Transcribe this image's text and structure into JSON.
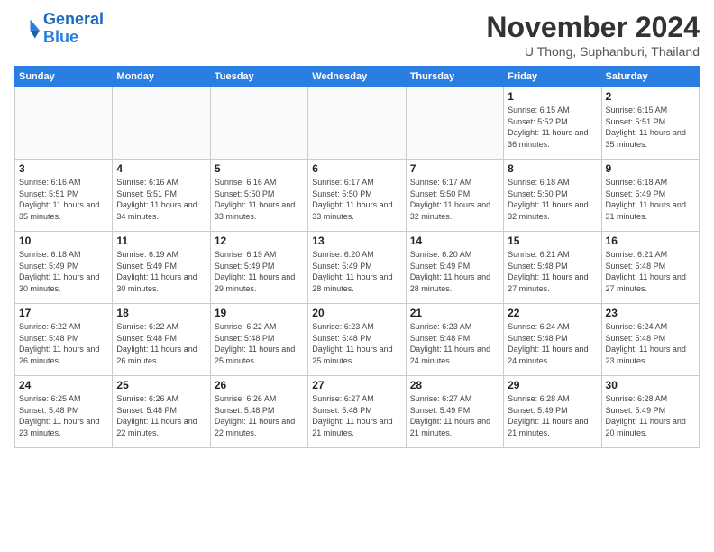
{
  "header": {
    "logo_line1": "General",
    "logo_line2": "Blue",
    "month_title": "November 2024",
    "location": "U Thong, Suphanburi, Thailand"
  },
  "weekdays": [
    "Sunday",
    "Monday",
    "Tuesday",
    "Wednesday",
    "Thursday",
    "Friday",
    "Saturday"
  ],
  "weeks": [
    [
      {
        "day": "",
        "info": ""
      },
      {
        "day": "",
        "info": ""
      },
      {
        "day": "",
        "info": ""
      },
      {
        "day": "",
        "info": ""
      },
      {
        "day": "",
        "info": ""
      },
      {
        "day": "1",
        "info": "Sunrise: 6:15 AM\nSunset: 5:52 PM\nDaylight: 11 hours and 36 minutes."
      },
      {
        "day": "2",
        "info": "Sunrise: 6:15 AM\nSunset: 5:51 PM\nDaylight: 11 hours and 35 minutes."
      }
    ],
    [
      {
        "day": "3",
        "info": "Sunrise: 6:16 AM\nSunset: 5:51 PM\nDaylight: 11 hours and 35 minutes."
      },
      {
        "day": "4",
        "info": "Sunrise: 6:16 AM\nSunset: 5:51 PM\nDaylight: 11 hours and 34 minutes."
      },
      {
        "day": "5",
        "info": "Sunrise: 6:16 AM\nSunset: 5:50 PM\nDaylight: 11 hours and 33 minutes."
      },
      {
        "day": "6",
        "info": "Sunrise: 6:17 AM\nSunset: 5:50 PM\nDaylight: 11 hours and 33 minutes."
      },
      {
        "day": "7",
        "info": "Sunrise: 6:17 AM\nSunset: 5:50 PM\nDaylight: 11 hours and 32 minutes."
      },
      {
        "day": "8",
        "info": "Sunrise: 6:18 AM\nSunset: 5:50 PM\nDaylight: 11 hours and 32 minutes."
      },
      {
        "day": "9",
        "info": "Sunrise: 6:18 AM\nSunset: 5:49 PM\nDaylight: 11 hours and 31 minutes."
      }
    ],
    [
      {
        "day": "10",
        "info": "Sunrise: 6:18 AM\nSunset: 5:49 PM\nDaylight: 11 hours and 30 minutes."
      },
      {
        "day": "11",
        "info": "Sunrise: 6:19 AM\nSunset: 5:49 PM\nDaylight: 11 hours and 30 minutes."
      },
      {
        "day": "12",
        "info": "Sunrise: 6:19 AM\nSunset: 5:49 PM\nDaylight: 11 hours and 29 minutes."
      },
      {
        "day": "13",
        "info": "Sunrise: 6:20 AM\nSunset: 5:49 PM\nDaylight: 11 hours and 28 minutes."
      },
      {
        "day": "14",
        "info": "Sunrise: 6:20 AM\nSunset: 5:49 PM\nDaylight: 11 hours and 28 minutes."
      },
      {
        "day": "15",
        "info": "Sunrise: 6:21 AM\nSunset: 5:48 PM\nDaylight: 11 hours and 27 minutes."
      },
      {
        "day": "16",
        "info": "Sunrise: 6:21 AM\nSunset: 5:48 PM\nDaylight: 11 hours and 27 minutes."
      }
    ],
    [
      {
        "day": "17",
        "info": "Sunrise: 6:22 AM\nSunset: 5:48 PM\nDaylight: 11 hours and 26 minutes."
      },
      {
        "day": "18",
        "info": "Sunrise: 6:22 AM\nSunset: 5:48 PM\nDaylight: 11 hours and 26 minutes."
      },
      {
        "day": "19",
        "info": "Sunrise: 6:22 AM\nSunset: 5:48 PM\nDaylight: 11 hours and 25 minutes."
      },
      {
        "day": "20",
        "info": "Sunrise: 6:23 AM\nSunset: 5:48 PM\nDaylight: 11 hours and 25 minutes."
      },
      {
        "day": "21",
        "info": "Sunrise: 6:23 AM\nSunset: 5:48 PM\nDaylight: 11 hours and 24 minutes."
      },
      {
        "day": "22",
        "info": "Sunrise: 6:24 AM\nSunset: 5:48 PM\nDaylight: 11 hours and 24 minutes."
      },
      {
        "day": "23",
        "info": "Sunrise: 6:24 AM\nSunset: 5:48 PM\nDaylight: 11 hours and 23 minutes."
      }
    ],
    [
      {
        "day": "24",
        "info": "Sunrise: 6:25 AM\nSunset: 5:48 PM\nDaylight: 11 hours and 23 minutes."
      },
      {
        "day": "25",
        "info": "Sunrise: 6:26 AM\nSunset: 5:48 PM\nDaylight: 11 hours and 22 minutes."
      },
      {
        "day": "26",
        "info": "Sunrise: 6:26 AM\nSunset: 5:48 PM\nDaylight: 11 hours and 22 minutes."
      },
      {
        "day": "27",
        "info": "Sunrise: 6:27 AM\nSunset: 5:48 PM\nDaylight: 11 hours and 21 minutes."
      },
      {
        "day": "28",
        "info": "Sunrise: 6:27 AM\nSunset: 5:49 PM\nDaylight: 11 hours and 21 minutes."
      },
      {
        "day": "29",
        "info": "Sunrise: 6:28 AM\nSunset: 5:49 PM\nDaylight: 11 hours and 21 minutes."
      },
      {
        "day": "30",
        "info": "Sunrise: 6:28 AM\nSunset: 5:49 PM\nDaylight: 11 hours and 20 minutes."
      }
    ]
  ]
}
